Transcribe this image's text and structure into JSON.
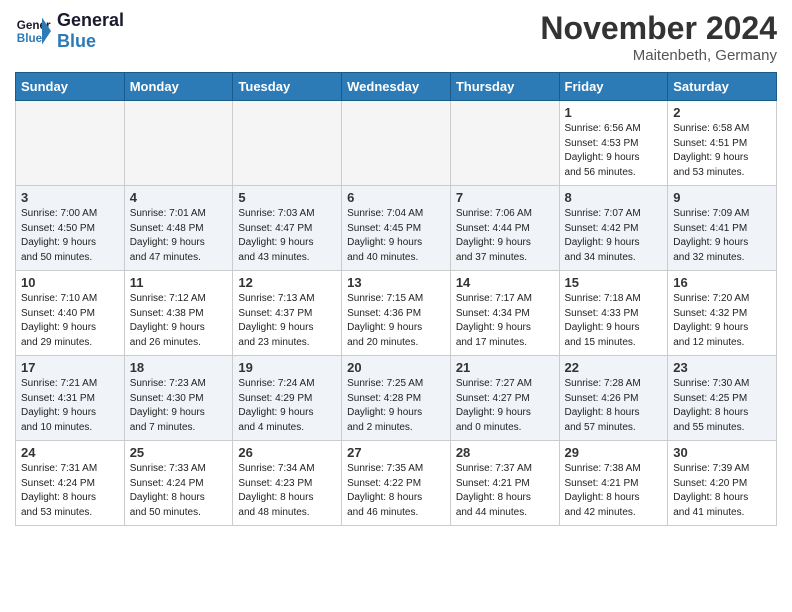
{
  "header": {
    "logo_line1": "General",
    "logo_line2": "Blue",
    "month": "November 2024",
    "location": "Maitenbeth, Germany"
  },
  "weekdays": [
    "Sunday",
    "Monday",
    "Tuesday",
    "Wednesday",
    "Thursday",
    "Friday",
    "Saturday"
  ],
  "weeks": [
    [
      {
        "day": "",
        "info": ""
      },
      {
        "day": "",
        "info": ""
      },
      {
        "day": "",
        "info": ""
      },
      {
        "day": "",
        "info": ""
      },
      {
        "day": "",
        "info": ""
      },
      {
        "day": "1",
        "info": "Sunrise: 6:56 AM\nSunset: 4:53 PM\nDaylight: 9 hours\nand 56 minutes."
      },
      {
        "day": "2",
        "info": "Sunrise: 6:58 AM\nSunset: 4:51 PM\nDaylight: 9 hours\nand 53 minutes."
      }
    ],
    [
      {
        "day": "3",
        "info": "Sunrise: 7:00 AM\nSunset: 4:50 PM\nDaylight: 9 hours\nand 50 minutes."
      },
      {
        "day": "4",
        "info": "Sunrise: 7:01 AM\nSunset: 4:48 PM\nDaylight: 9 hours\nand 47 minutes."
      },
      {
        "day": "5",
        "info": "Sunrise: 7:03 AM\nSunset: 4:47 PM\nDaylight: 9 hours\nand 43 minutes."
      },
      {
        "day": "6",
        "info": "Sunrise: 7:04 AM\nSunset: 4:45 PM\nDaylight: 9 hours\nand 40 minutes."
      },
      {
        "day": "7",
        "info": "Sunrise: 7:06 AM\nSunset: 4:44 PM\nDaylight: 9 hours\nand 37 minutes."
      },
      {
        "day": "8",
        "info": "Sunrise: 7:07 AM\nSunset: 4:42 PM\nDaylight: 9 hours\nand 34 minutes."
      },
      {
        "day": "9",
        "info": "Sunrise: 7:09 AM\nSunset: 4:41 PM\nDaylight: 9 hours\nand 32 minutes."
      }
    ],
    [
      {
        "day": "10",
        "info": "Sunrise: 7:10 AM\nSunset: 4:40 PM\nDaylight: 9 hours\nand 29 minutes."
      },
      {
        "day": "11",
        "info": "Sunrise: 7:12 AM\nSunset: 4:38 PM\nDaylight: 9 hours\nand 26 minutes."
      },
      {
        "day": "12",
        "info": "Sunrise: 7:13 AM\nSunset: 4:37 PM\nDaylight: 9 hours\nand 23 minutes."
      },
      {
        "day": "13",
        "info": "Sunrise: 7:15 AM\nSunset: 4:36 PM\nDaylight: 9 hours\nand 20 minutes."
      },
      {
        "day": "14",
        "info": "Sunrise: 7:17 AM\nSunset: 4:34 PM\nDaylight: 9 hours\nand 17 minutes."
      },
      {
        "day": "15",
        "info": "Sunrise: 7:18 AM\nSunset: 4:33 PM\nDaylight: 9 hours\nand 15 minutes."
      },
      {
        "day": "16",
        "info": "Sunrise: 7:20 AM\nSunset: 4:32 PM\nDaylight: 9 hours\nand 12 minutes."
      }
    ],
    [
      {
        "day": "17",
        "info": "Sunrise: 7:21 AM\nSunset: 4:31 PM\nDaylight: 9 hours\nand 10 minutes."
      },
      {
        "day": "18",
        "info": "Sunrise: 7:23 AM\nSunset: 4:30 PM\nDaylight: 9 hours\nand 7 minutes."
      },
      {
        "day": "19",
        "info": "Sunrise: 7:24 AM\nSunset: 4:29 PM\nDaylight: 9 hours\nand 4 minutes."
      },
      {
        "day": "20",
        "info": "Sunrise: 7:25 AM\nSunset: 4:28 PM\nDaylight: 9 hours\nand 2 minutes."
      },
      {
        "day": "21",
        "info": "Sunrise: 7:27 AM\nSunset: 4:27 PM\nDaylight: 9 hours\nand 0 minutes."
      },
      {
        "day": "22",
        "info": "Sunrise: 7:28 AM\nSunset: 4:26 PM\nDaylight: 8 hours\nand 57 minutes."
      },
      {
        "day": "23",
        "info": "Sunrise: 7:30 AM\nSunset: 4:25 PM\nDaylight: 8 hours\nand 55 minutes."
      }
    ],
    [
      {
        "day": "24",
        "info": "Sunrise: 7:31 AM\nSunset: 4:24 PM\nDaylight: 8 hours\nand 53 minutes."
      },
      {
        "day": "25",
        "info": "Sunrise: 7:33 AM\nSunset: 4:24 PM\nDaylight: 8 hours\nand 50 minutes."
      },
      {
        "day": "26",
        "info": "Sunrise: 7:34 AM\nSunset: 4:23 PM\nDaylight: 8 hours\nand 48 minutes."
      },
      {
        "day": "27",
        "info": "Sunrise: 7:35 AM\nSunset: 4:22 PM\nDaylight: 8 hours\nand 46 minutes."
      },
      {
        "day": "28",
        "info": "Sunrise: 7:37 AM\nSunset: 4:21 PM\nDaylight: 8 hours\nand 44 minutes."
      },
      {
        "day": "29",
        "info": "Sunrise: 7:38 AM\nSunset: 4:21 PM\nDaylight: 8 hours\nand 42 minutes."
      },
      {
        "day": "30",
        "info": "Sunrise: 7:39 AM\nSunset: 4:20 PM\nDaylight: 8 hours\nand 41 minutes."
      }
    ]
  ]
}
